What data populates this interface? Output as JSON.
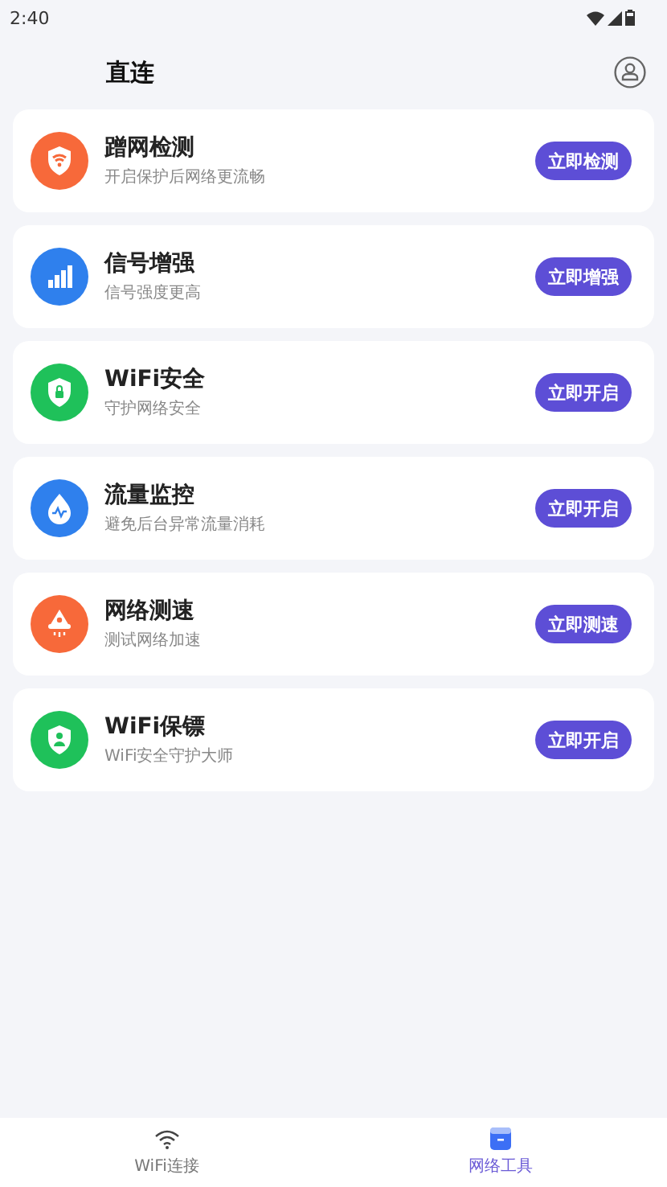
{
  "status_bar": {
    "time": "2:40"
  },
  "header": {
    "title": "直连"
  },
  "tools": [
    {
      "kind": "wifishield",
      "color": "#f7693a",
      "title": "蹭网检测",
      "subtitle": "开启保护后网络更流畅",
      "action": "立即检测"
    },
    {
      "kind": "signal",
      "color": "#2f80ed",
      "title": "信号增强",
      "subtitle": "信号强度更高",
      "action": "立即增强"
    },
    {
      "kind": "lockshield",
      "color": "#1fc15a",
      "title": "WiFi安全",
      "subtitle": "守护网络安全",
      "action": "立即开启"
    },
    {
      "kind": "drop",
      "color": "#2f80ed",
      "title": "流量监控",
      "subtitle": "避免后台异常流量消耗",
      "action": "立即开启"
    },
    {
      "kind": "rocket",
      "color": "#f7693a",
      "title": "网络测速",
      "subtitle": "测试网络加速",
      "action": "立即测速"
    },
    {
      "kind": "guardshield",
      "color": "#1fc15a",
      "title": "WiFi保镖",
      "subtitle": "WiFi安全守护大师",
      "action": "立即开启"
    }
  ],
  "tabs": [
    {
      "kind": "wifi",
      "label": "WiFi连接",
      "selected": false
    },
    {
      "kind": "toolbox",
      "label": "网络工具",
      "selected": true
    }
  ]
}
